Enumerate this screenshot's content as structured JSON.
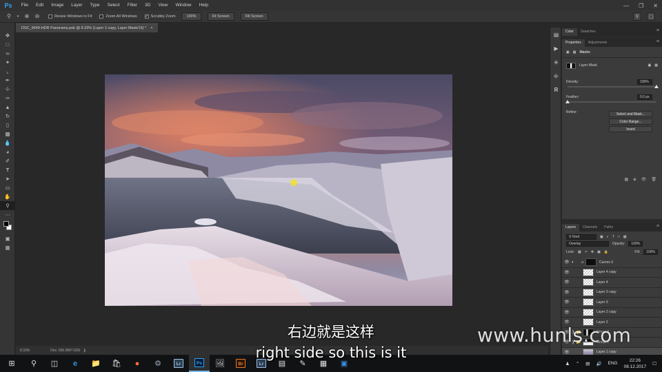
{
  "app": {
    "logo_text": "Ps",
    "menu": [
      "File",
      "Edit",
      "Image",
      "Layer",
      "Type",
      "Select",
      "Filter",
      "3D",
      "View",
      "Window",
      "Help"
    ],
    "window_controls": [
      "—",
      "❐",
      "✕"
    ]
  },
  "options_bar": {
    "tool_icon": "zoom-icon",
    "resize_windows_label": "Resize Windows to Fit",
    "resize_windows_checked": false,
    "zoom_all_label": "Zoom All Windows",
    "zoom_all_checked": false,
    "scrubby_label": "Scrubby Zoom",
    "scrubby_checked": true,
    "btn_100": "100%",
    "btn_fit": "Fit Screen",
    "btn_fill": "Fill Screen"
  },
  "document": {
    "tab_title": "DSC_9649-HDR Panorama.psb @ 8.33% (Layer 1 copy, Layer Mask/16) *",
    "close_glyph": "×",
    "zoom_level": "8.33%",
    "doc_info": "Doc: 556.9M/7.63G"
  },
  "right_panel": {
    "top_tabs": [
      "Color",
      "Swatches"
    ],
    "props_tabs": [
      "Properties",
      "Adjustments"
    ],
    "masks_label": "Masks",
    "layer_mask_label": "Layer Mask",
    "density_label": "Density:",
    "density_value": "100%",
    "density_fraction": 1.0,
    "feather_label": "Feather:",
    "feather_value": "0.0 px",
    "feather_fraction": 0.0,
    "refine_label": "Refine:",
    "btn_select_mask": "Select and Mask...",
    "btn_color_range": "Color Range...",
    "btn_invert": "Invert"
  },
  "layers_panel": {
    "tabs": [
      "Layers",
      "Channels",
      "Paths"
    ],
    "kind_label": "Kind",
    "blend_mode": "Overlay",
    "opacity_label": "Opacity:",
    "opacity_value": "100%",
    "lock_label": "Lock:",
    "fill_label": "Fill:",
    "fill_value": "100%",
    "layers": [
      {
        "name": "Curves 3",
        "thumb": "black",
        "adjustment": true
      },
      {
        "name": "Layer 4 copy",
        "thumb": "checker"
      },
      {
        "name": "Layer 4",
        "thumb": "checker"
      },
      {
        "name": "Layer 3 copy",
        "thumb": "checker"
      },
      {
        "name": "Layer 3",
        "thumb": "checker"
      },
      {
        "name": "Layer 2 copy",
        "thumb": "checker"
      },
      {
        "name": "Layer 2",
        "thumb": "checker"
      },
      {
        "name": "Group 2",
        "thumb": "mask",
        "group": true
      },
      {
        "name": "Group 1",
        "thumb": "mask",
        "group": true
      },
      {
        "name": "Layer 1 copy",
        "thumb": "snow",
        "selected": true
      }
    ]
  },
  "overlay": {
    "subtitle_cn": "右边就是这样",
    "subtitle_en": "right side so this is it",
    "watermark": "www.hunls.com"
  },
  "taskbar": {
    "language": "ENG",
    "time": "22:26",
    "date": "08.12.2017",
    "accent": "#76b9ed"
  },
  "colors": {
    "ps_blue": "#2fa3f6",
    "lr_bg": "#2c3e50",
    "br_orange": "#e87c2b"
  }
}
